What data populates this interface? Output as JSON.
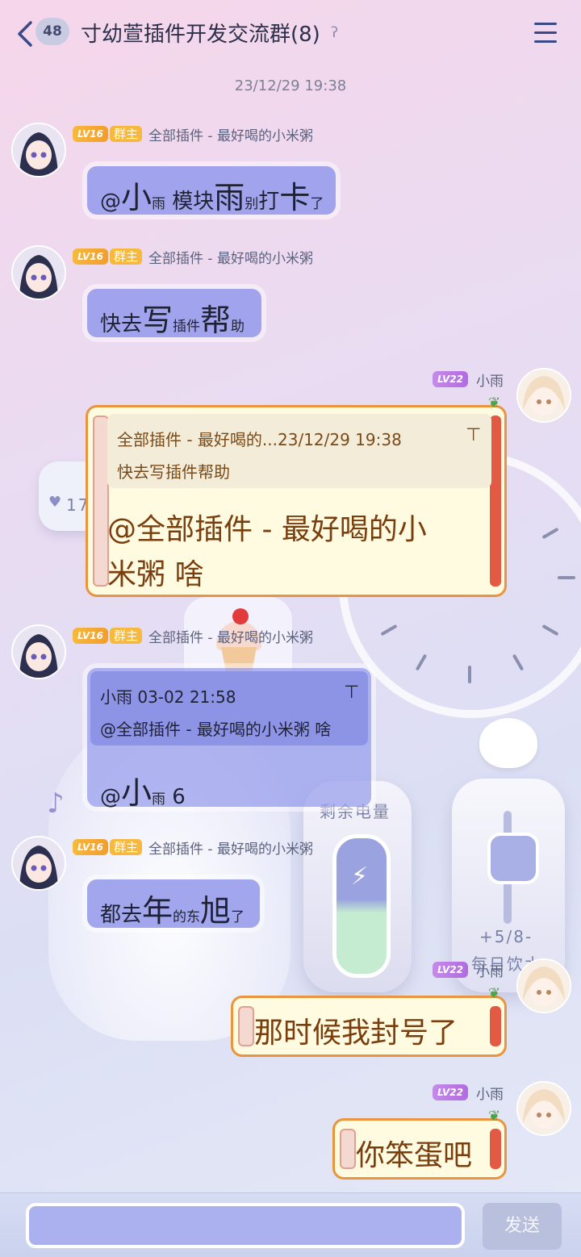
{
  "header": {
    "back_icon": "chevron-left-icon",
    "unread_count": "48",
    "title": "寸幼萱插件开发交流群(8)",
    "ear_icon": "ear-icon",
    "menu_icon": "hamburger-menu-icon"
  },
  "timestamp": "23/12/29 19:38",
  "messages": [
    {
      "sender": "全部插件 - 最好喝的小米粥",
      "level": "LV16",
      "role": "群主",
      "segments": [
        [
          "@",
          ""
        ],
        [
          "小",
          "big"
        ],
        [
          "雨",
          "sm"
        ],
        [
          " 模块",
          ""
        ],
        [
          "雨",
          "big"
        ],
        [
          "别",
          "sm"
        ],
        [
          "打",
          ""
        ],
        [
          "卡",
          "big"
        ],
        [
          "了",
          "sm"
        ]
      ]
    },
    {
      "sender": "全部插件 - 最好喝的小米粥",
      "level": "LV16",
      "role": "群主",
      "segments": [
        [
          "快去",
          ""
        ],
        [
          "写",
          "big"
        ],
        [
          "插件",
          "sm"
        ],
        [
          "帮",
          "big"
        ],
        [
          "助",
          "sm"
        ]
      ]
    },
    {
      "sender": "小雨",
      "level": "LV22",
      "quote_header": "全部插件 - 最好喝的...23/12/29 19:38",
      "quote_text": "快去写插件帮助",
      "text_line1": "@全部插件 - 最好喝的小",
      "text_line2": "米粥 啥"
    },
    {
      "sender": "全部插件 - 最好喝的小米粥",
      "level": "LV16",
      "role": "群主",
      "quote_header": "小雨 03-02 21:58",
      "quote_text": "@全部插件 - 最好喝的小米粥 啥",
      "segments": [
        [
          "@",
          ""
        ],
        [
          "小",
          "big"
        ],
        [
          "雨",
          "sm"
        ],
        [
          " 6",
          ""
        ]
      ]
    },
    {
      "sender": "全部插件 - 最好喝的小米粥",
      "level": "LV16",
      "role": "群主",
      "segments": [
        [
          "都去",
          ""
        ],
        [
          "年",
          "big"
        ],
        [
          "的",
          "sm"
        ],
        [
          "东",
          "sm"
        ],
        [
          "旭",
          "big"
        ],
        [
          "了",
          "sm"
        ]
      ]
    },
    {
      "sender": "小雨",
      "level": "LV22",
      "text": "那时候我封号了"
    },
    {
      "sender": "小雨",
      "level": "LV22",
      "text": "你笨蛋吧"
    }
  ],
  "background": {
    "battery_label": "剩余电量",
    "water_count": "+5/8-",
    "water_label": "每日饮水",
    "card_number": "17"
  },
  "input": {
    "placeholder": "",
    "send_label": "发送"
  },
  "colors": {
    "left_bubble": "#9aa0ec",
    "right_bubble_bg": "#fffbe0",
    "right_bubble_border": "#e8953e",
    "send_button": "#b8c0de"
  }
}
